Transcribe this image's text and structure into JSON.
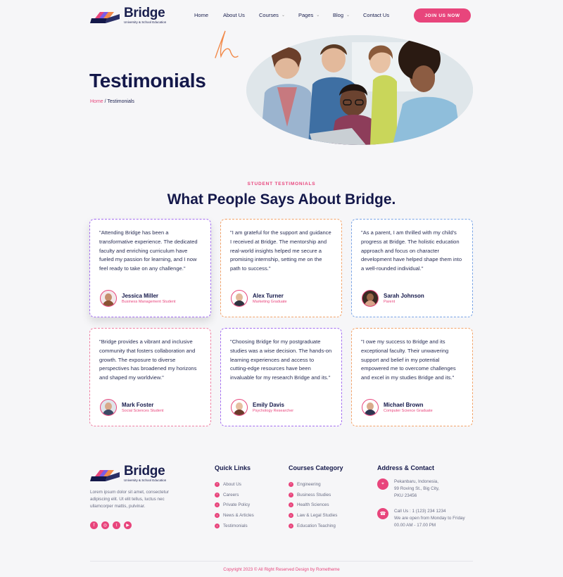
{
  "brand": {
    "name": "Bridge",
    "tagline": "University & School Education"
  },
  "nav": {
    "items": [
      {
        "label": "Home",
        "has_dropdown": false
      },
      {
        "label": "About Us",
        "has_dropdown": false
      },
      {
        "label": "Courses",
        "has_dropdown": true
      },
      {
        "label": "Pages",
        "has_dropdown": true
      },
      {
        "label": "Blog",
        "has_dropdown": true
      },
      {
        "label": "Contact Us",
        "has_dropdown": false
      }
    ],
    "cta": "JOIN US NOW"
  },
  "hero": {
    "title": "Testimonials",
    "breadcrumb_home": "Home",
    "breadcrumb_sep": " / ",
    "breadcrumb_current": "Testimonials"
  },
  "section": {
    "eyebrow": "STUDENT TESTIMONIALS",
    "title": "What People Says About Bridge."
  },
  "testimonials": [
    {
      "quote": "\"Attending Bridge has been a transformative experience. The dedicated faculty and enriching curriculum have fueled my passion for learning, and I now feel ready to take on any challenge.\"",
      "name": "Jessica Miller",
      "role": "Business Management Student"
    },
    {
      "quote": "\"I am grateful for the support and guidance I received at Bridge. The mentorship and real-world insights helped me secure a promising internship, setting me on the path to success.\"",
      "name": "Alex Turner",
      "role": "Marketing Graduate"
    },
    {
      "quote": "\"As a parent, I am thrilled with my child's progress at Bridge. The holistic education approach and focus on character development have helped shape them into a well-rounded individual.\"",
      "name": "Sarah Johnson",
      "role": "Parent"
    },
    {
      "quote": "\"Bridge provides a vibrant and inclusive community that fosters collaboration and growth. The exposure to diverse perspectives has broadened my horizons and shaped my worldview.\"",
      "name": "Mark Foster",
      "role": "Social Sciences Student"
    },
    {
      "quote": "\"Choosing Bridge for my postgraduate studies was a wise decision. The hands-on learning experiences and access to cutting-edge resources have been invaluable for my research Bridge and its.\"",
      "name": "Emily Davis",
      "role": "Psychology Researcher"
    },
    {
      "quote": "\"I owe my success to Bridge and its exceptional faculty. Their unwavering support and belief in my potential empowered me to overcome challenges and excel in my studies Bridge and its.\"",
      "name": "Michael Brown",
      "role": "Computer Science Graduate"
    }
  ],
  "footer": {
    "description": "Lorem ipsum dolor sit amet, consectetur adipiscing elit. Ut elit tellus, luctus nec ullamcorper mattis, pulvinar.",
    "quick_links_title": "Quick Links",
    "quick_links": [
      "About Us",
      "Careers",
      "Private Policy",
      "News & Articles",
      "Testimonials"
    ],
    "courses_title": "Courses Category",
    "courses": [
      "Engineering",
      "Business Studies",
      "Health Sciences",
      "Law & Legal Studies",
      "Education Teaching"
    ],
    "address_title": "Address & Contact",
    "address_lines": [
      "Pekanbaru, Indonesia,",
      "99 Roving St., Big City,",
      "PKU 23456"
    ],
    "contact_lines": [
      "Call Us : 1 (123) 234 1234",
      "We are open from Monday to Friday",
      "00.00 AM - 17.00 PM"
    ],
    "copyright": "Copyright 2023 © All Right Reserved Design by Rometheme"
  },
  "colors": {
    "accent": "#e8457c",
    "navy": "#14184a"
  },
  "icons": [
    "facebook-icon",
    "instagram-icon",
    "twitter-icon",
    "youtube-icon",
    "location-icon",
    "phone-icon"
  ]
}
